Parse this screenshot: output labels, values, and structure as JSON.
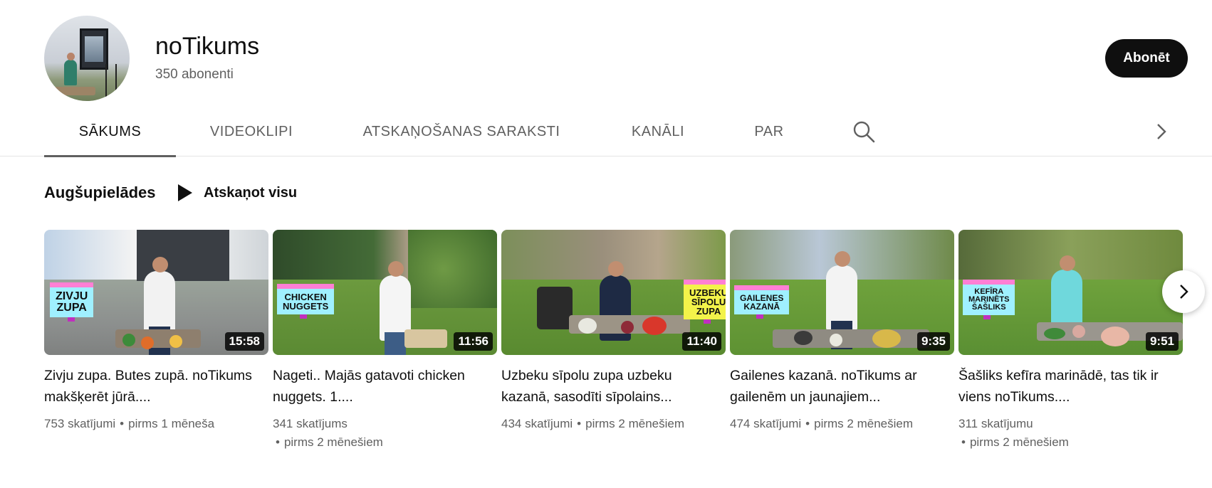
{
  "channel": {
    "name": "noTikums",
    "subscribers": "350 abonenti",
    "subscribe_label": "Abonēt"
  },
  "tabs": [
    {
      "label": "SĀKUMS",
      "active": true
    },
    {
      "label": "VIDEOKLIPI",
      "active": false
    },
    {
      "label": "ATSKAŅOŠANAS SARAKSTI",
      "active": false
    },
    {
      "label": "KANĀLI",
      "active": false
    },
    {
      "label": "PAR",
      "active": false
    }
  ],
  "icons": {
    "search": "search-icon",
    "tabs_next": "chevron-right-icon",
    "carousel_next": "chevron-right-icon",
    "play": "play-icon"
  },
  "section": {
    "title": "Augšupielādes",
    "play_all": "Atskaņot visu"
  },
  "videos": [
    {
      "title": "Zivju zupa. Butes zupā. noTikums makšķerēt jūrā....",
      "duration": "15:58",
      "views": "753 skatījumi",
      "age": "pirms 1 mēneša",
      "badge": [
        "ZIVJU",
        "ZUPA"
      ]
    },
    {
      "title": "Nageti.. Majās gatavoti chicken nuggets. 1....",
      "duration": "11:56",
      "views": "341 skatījums",
      "age": "pirms 2 mēnešiem",
      "badge": [
        "CHICKEN",
        "NUGGETS"
      ]
    },
    {
      "title": "Uzbeku sīpolu zupa uzbeku kazanā, sasodīti sīpolains...",
      "duration": "11:40",
      "views": "434 skatījumi",
      "age": "pirms 2 mēnešiem",
      "badge": [
        "UZBEKU",
        "SĪPOLU",
        "ZUPA"
      ]
    },
    {
      "title": "Gailenes kazanā. noTikums ar gailenēm un jaunajiem...",
      "duration": "9:35",
      "views": "474 skatījumi",
      "age": "pirms 2 mēnešiem",
      "badge": [
        "GAILENES",
        "KAZANĀ"
      ]
    },
    {
      "title": "Šašliks kefīra marinādē, tas tik ir viens noTikums....",
      "duration": "9:51",
      "views": "311 skatījumu",
      "age": "pirms 2 mēnešiem",
      "badge": [
        "KEFĪRA",
        "MARINĒTS",
        "ŠAŠLIKS"
      ]
    }
  ],
  "colors": {
    "text_primary": "#0f0f0f",
    "text_secondary": "#606060",
    "subscribe_bg": "#0f0f0f",
    "badge_cyan": "#9ff0ff",
    "badge_yellow": "#f3f34a",
    "badge_pink": "#ff7fd4"
  }
}
